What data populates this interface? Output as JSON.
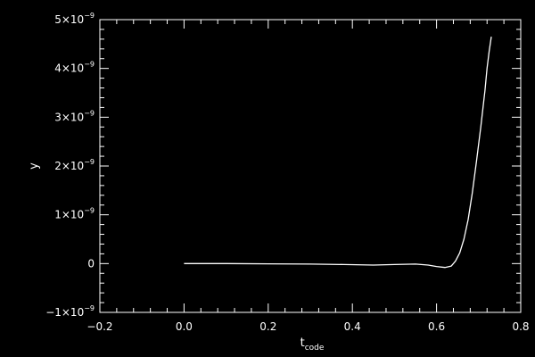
{
  "chart_data": {
    "type": "line",
    "title": "",
    "xlabel": "t",
    "xlabel_subscript": "code",
    "ylabel": "y",
    "xlim": [
      -0.2,
      0.8
    ],
    "ylim": [
      -1e-09,
      5e-09
    ],
    "x_major_ticks": [
      -0.2,
      0.0,
      0.2,
      0.4,
      0.6,
      0.8
    ],
    "x_tick_labels": [
      "−0.2",
      "0.0",
      "0.2",
      "0.4",
      "0.6",
      "0.8"
    ],
    "y_major_ticks": [
      -1e-09,
      0,
      1e-09,
      2e-09,
      3e-09,
      4e-09,
      5e-09
    ],
    "y_tick_labels": [
      {
        "mant": "−1×10",
        "exp": "−9"
      },
      {
        "mant": "0",
        "exp": ""
      },
      {
        "mant": "1×10",
        "exp": "−9"
      },
      {
        "mant": "2×10",
        "exp": "−9"
      },
      {
        "mant": "3×10",
        "exp": "−9"
      },
      {
        "mant": "4×10",
        "exp": "−9"
      },
      {
        "mant": "5×10",
        "exp": "−9"
      }
    ],
    "x_minor_per_major": 4,
    "y_minor_per_major": 4,
    "grid": false,
    "background": "#000000",
    "foreground": "#ffffff",
    "series": [
      {
        "color": "#ffffff",
        "x": [
          0.0,
          0.1,
          0.2,
          0.3,
          0.38,
          0.45,
          0.5,
          0.55,
          0.58,
          0.6,
          0.62,
          0.635,
          0.645,
          0.655,
          0.665,
          0.675,
          0.685,
          0.695,
          0.705,
          0.715,
          0.72,
          0.725,
          0.73
        ],
        "y": [
          0,
          0,
          -5e-12,
          -1e-11,
          -2e-11,
          -3e-11,
          -2e-11,
          -1e-11,
          -3e-11,
          -6e-11,
          -8e-11,
          -5e-11,
          5e-11,
          2.2e-10,
          5e-10,
          9e-10,
          1.45e-09,
          2.1e-09,
          2.8e-09,
          3.55e-09,
          4e-09,
          4.35e-09,
          4.65e-09
        ]
      }
    ]
  }
}
